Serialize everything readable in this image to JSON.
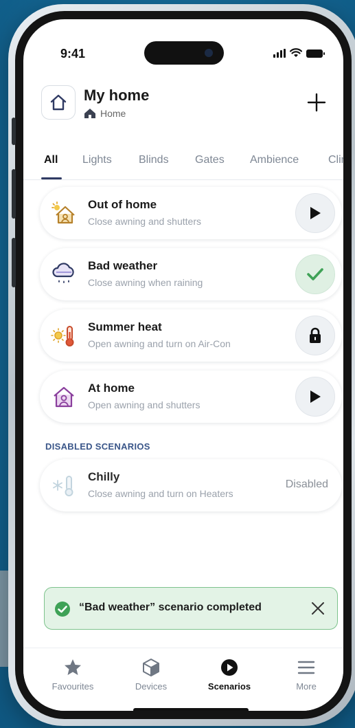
{
  "status": {
    "time": "9:41"
  },
  "header": {
    "title": "My home",
    "subtitle": "Home"
  },
  "tabs": [
    {
      "label": "All"
    },
    {
      "label": "Lights"
    },
    {
      "label": "Blinds"
    },
    {
      "label": "Gates"
    },
    {
      "label": "Ambience"
    },
    {
      "label": "Clim"
    }
  ],
  "scenarios": [
    {
      "title": "Out of home",
      "subtitle": "Close awning and shutters",
      "icon": "house-sun-icon",
      "action": "play-icon"
    },
    {
      "title": "Bad weather",
      "subtitle": "Close awning when raining",
      "icon": "rain-cloud-icon",
      "action": "check-icon"
    },
    {
      "title": "Summer heat",
      "subtitle": "Open awning and turn on Air-Con",
      "icon": "sun-thermometer-icon",
      "action": "lock-icon"
    },
    {
      "title": "At home",
      "subtitle": "Open awning and shutters",
      "icon": "house-person-icon",
      "action": "play-icon"
    }
  ],
  "disabled_section": {
    "title": "DISABLED SCENARIOS",
    "items": [
      {
        "title": "Chilly",
        "subtitle": "Close awning and turn on Heaters",
        "status": "Disabled",
        "icon": "snow-thermometer-icon"
      }
    ]
  },
  "toast": {
    "message": "“Bad weather” scenario completed"
  },
  "nav": [
    {
      "label": "Favourites",
      "icon": "star-icon"
    },
    {
      "label": "Devices",
      "icon": "cube-icon"
    },
    {
      "label": "Scenarios",
      "icon": "play-circle-icon"
    },
    {
      "label": "More",
      "icon": "menu-icon"
    }
  ],
  "colors": {
    "accent": "#2f3a63",
    "success": "#3fa257",
    "section": "#3a5689",
    "background": "#156a98"
  }
}
